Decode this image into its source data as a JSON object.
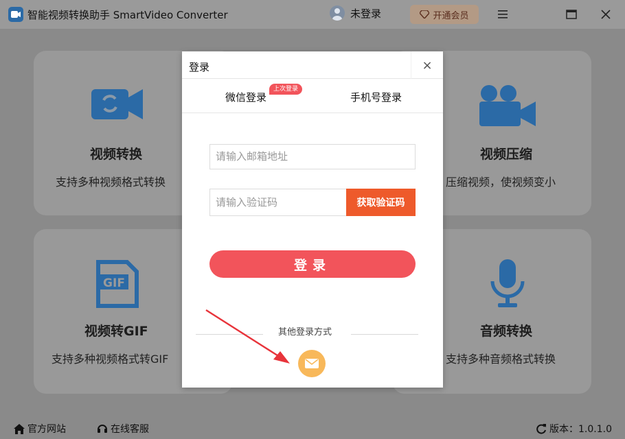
{
  "app": {
    "title": "智能视频转换助手 SmartVideo Converter",
    "user_status": "未登录",
    "vip_label": "开通会员"
  },
  "cards": [
    {
      "title": "视频转换",
      "desc": "支持多种视频格式转换",
      "icon": "video-convert-icon"
    },
    {
      "title": "视频压缩",
      "desc": "压缩视频，使视频变小",
      "icon": "video-camera-icon"
    },
    {
      "title": "视频转GIF",
      "desc": "支持多种视频格式转GIF",
      "icon": "gif-file-icon"
    },
    {
      "title": "音频转换",
      "desc": "支持多种音频格式转换",
      "icon": "microphone-icon"
    }
  ],
  "footer": {
    "website": "官方网站",
    "support": "在线客服",
    "version": "版本：1.0.1.0"
  },
  "dialog": {
    "title": "登录",
    "close": "×",
    "tabs": [
      {
        "label": "微信登录",
        "badge": "上次登录"
      },
      {
        "label": "手机号登录"
      }
    ],
    "email_placeholder": "请输入邮箱地址",
    "code_placeholder": "请输入验证码",
    "get_code_label": "获取验证码",
    "login_label": "登录",
    "other_methods_label": "其他登录方式"
  },
  "colors": {
    "accent_red": "#f2545b",
    "code_button": "#ee5a2b",
    "mail_button": "#f8b85a",
    "icon_blue": "#2b6aa6"
  }
}
